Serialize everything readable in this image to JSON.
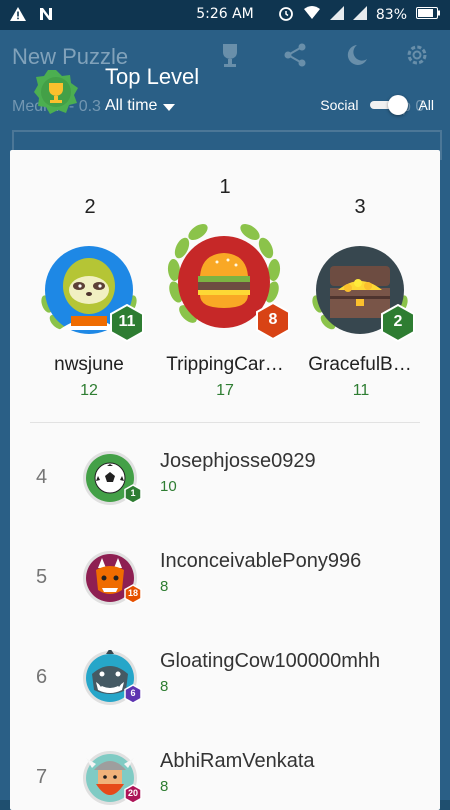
{
  "status_bar": {
    "time": "5:26 AM",
    "battery": "83%"
  },
  "background_app": {
    "title": "New Puzzle",
    "subtitle": "Median - 0.3",
    "xp": "xp 0"
  },
  "header": {
    "title": "Top Level",
    "period": "All time",
    "toggle_left": "Social",
    "toggle_right": "All"
  },
  "podium": [
    {
      "rank": "2",
      "name": "nwsjune",
      "score": "12",
      "level": "11",
      "avatar": "sloth-avatar",
      "level_color": "#2e7d32"
    },
    {
      "rank": "1",
      "name": "TrippingCar…",
      "score": "17",
      "level": "8",
      "avatar": "burger-avatar",
      "level_color": "#d84315"
    },
    {
      "rank": "3",
      "name": "GracefulB…",
      "score": "11",
      "level": "2",
      "avatar": "treasure-avatar",
      "level_color": "#2e7d32"
    }
  ],
  "list": [
    {
      "rank": "4",
      "name": "Josephjosse0929",
      "score": "10",
      "level": "1",
      "avatar": "soccer-ball-avatar",
      "level_color": "#2e7d32"
    },
    {
      "rank": "5",
      "name": "InconceivablePony996",
      "score": "8",
      "level": "18",
      "avatar": "dragon-avatar",
      "level_color": "#e65100"
    },
    {
      "rank": "6",
      "name": "GloatingCow100000mhh",
      "score": "8",
      "level": "6",
      "avatar": "shark-avatar",
      "level_color": "#5e35b1"
    },
    {
      "rank": "7",
      "name": "AbhiRamVenkata",
      "score": "8",
      "level": "20",
      "avatar": "viking-avatar",
      "level_color": "#ad1457"
    }
  ]
}
